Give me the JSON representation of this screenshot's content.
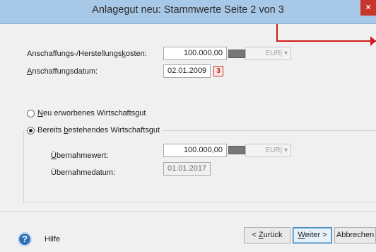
{
  "window": {
    "title": "Anlagegut neu: Stammwerte Seite 2 von 3",
    "close_label": "×"
  },
  "cost": {
    "label_pre": "Anschaffungs-/Herstellungs",
    "label_key": "k",
    "label_post": "osten:",
    "value": "100.000,00",
    "currency": "EUR|",
    "dropdown_glyph": "▾"
  },
  "date": {
    "label_key": "A",
    "label_post": "nschaffungsdatum:",
    "value": "02.01.2009",
    "calendar_glyph": "3"
  },
  "radio_new": {
    "label_key": "N",
    "label_post": "eu erworbenes Wirtschaftsgut",
    "selected": false
  },
  "radio_existing": {
    "label_pre": "Bereits ",
    "label_key": "b",
    "label_post": "estehendes Wirtschaftsgut",
    "selected": true
  },
  "takeover_value": {
    "label_key": "Ü",
    "label_post": "bernahmewert:",
    "value": "100.000,00",
    "currency": "EUR|",
    "dropdown_glyph": "▾"
  },
  "takeover_date": {
    "label": "Übernahmedatum:",
    "value": "01.01.2017"
  },
  "footer": {
    "help_glyph": "?",
    "help_label": "Hilfe",
    "back_pre": "< ",
    "back_key": "Z",
    "back_post": "urück",
    "next_key": "W",
    "next_post": "eiter >",
    "cancel_label": "Abbrechen"
  }
}
